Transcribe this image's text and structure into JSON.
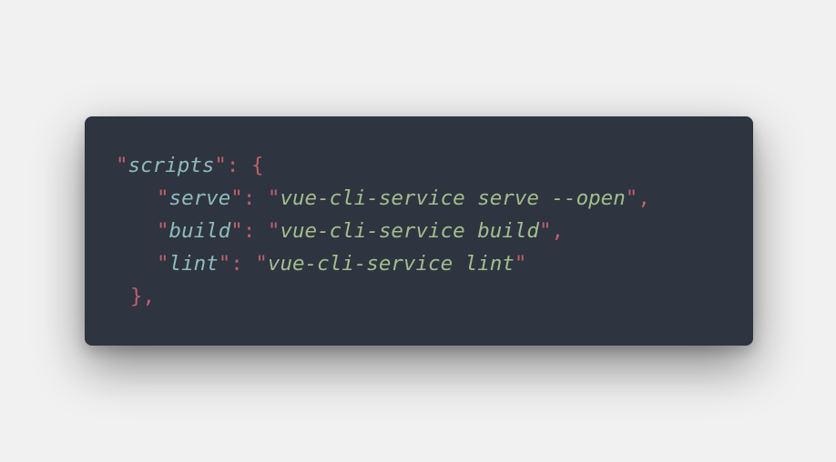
{
  "code": {
    "language": "json",
    "lines": [
      {
        "key": "scripts",
        "open_brace": "{"
      },
      {
        "key": "serve",
        "value": "vue-cli-service serve --open",
        "trailing": ","
      },
      {
        "key": "build",
        "value": "vue-cli-service build",
        "trailing": ","
      },
      {
        "key": "lint",
        "value": "vue-cli-service lint",
        "trailing": ""
      },
      {
        "close": "},"
      }
    ]
  },
  "colors": {
    "page_background": "#f1f1f1",
    "card_background": "#2e3440",
    "punctuation": "#bf616a",
    "key": "#8fbcbb",
    "string": "#a3be8c"
  }
}
